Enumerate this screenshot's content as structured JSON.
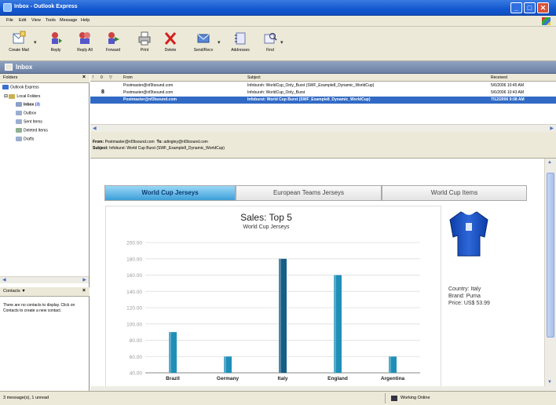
{
  "window": {
    "title": "Inbox - Outlook Express"
  },
  "menu": [
    "File",
    "Edit",
    "View",
    "Tools",
    "Message",
    "Help"
  ],
  "toolbar": {
    "buttons": [
      {
        "label": "Create Mail"
      },
      {
        "label": "Reply"
      },
      {
        "label": "Reply All"
      },
      {
        "label": "Forward"
      },
      {
        "label": "Print"
      },
      {
        "label": "Delete"
      },
      {
        "label": "Send/Recv"
      },
      {
        "label": "Addresses"
      },
      {
        "label": "Find"
      }
    ]
  },
  "folderbar": {
    "title": "Inbox"
  },
  "folders": {
    "header": "Folders",
    "items": [
      {
        "label": "Outlook Express"
      },
      {
        "label": "Local Folders"
      },
      {
        "label": "Inbox",
        "count": "(3)"
      },
      {
        "label": "Outbox"
      },
      {
        "label": "Sent Items"
      },
      {
        "label": "Deleted Items"
      },
      {
        "label": "Drafts"
      }
    ]
  },
  "contacts": {
    "header": "Contacts ▼",
    "message": "There are no contacts to display. Click on Contacts to create a new contact."
  },
  "message_list": {
    "columns": [
      "!",
      "0",
      "▽",
      "From",
      "Subject",
      "Received"
    ],
    "rows": [
      {
        "from": "Postmaster@nf3tsound.com",
        "subject": "Infobursh: WorldCup_Only_Burst (SWF_Example8_Dynamic_WorldCup)",
        "received": "5/6/2006 10:45 AM",
        "selected": false
      },
      {
        "from": "Postmaster@nf3tsound.com",
        "subject": "Infobursh: WorldCup_Only_Burst",
        "received": "5/6/2006 10:43 AM",
        "selected": false
      },
      {
        "from": "Postmaster@nf3tsound.com",
        "subject": "Infoburst: World Cup Burst (SWF_Example8_Dynamic_WorldCup)",
        "received": "7/12/2006 9:08 AM",
        "selected": true
      }
    ]
  },
  "preview": {
    "from_label": "From:",
    "from": "Postmaster@nf3tsound.com",
    "to_label": "To:",
    "to": "adingley@nf3tsound.com",
    "subject_label": "Subject:",
    "subject": "Infoburst: World Cup Burst (SWF_Example8_Dynamic_WorldCup)"
  },
  "tabs": [
    {
      "label": "World Cup Jerseys",
      "active": true
    },
    {
      "label": "European Teams Jerseys",
      "active": false
    },
    {
      "label": "World Cup Items",
      "active": false
    }
  ],
  "product": {
    "country": "Country: Italy",
    "brand": "Brand: Puma",
    "price": "Price: US$ 53.99"
  },
  "chart_data": {
    "type": "bar",
    "title": "Sales: Top 5",
    "subtitle": "World Cup Jerseys",
    "categories": [
      "Brazil",
      "Germany",
      "Italy",
      "England",
      "Argentina"
    ],
    "values": [
      9000,
      6000,
      18000,
      16000,
      6000
    ],
    "ylim": [
      4000,
      20000
    ],
    "yticks": [
      4000,
      6000,
      8000,
      10000,
      12000,
      14000,
      16000,
      18000,
      20000
    ],
    "ytick_labels": [
      "40.00",
      "60.00",
      "80.00",
      "100.00",
      "120.00",
      "140.00",
      "160.00",
      "180.00",
      "200.00"
    ],
    "colors": {
      "bar": "#1f8fb8",
      "bar_highlight": "#155f86"
    }
  },
  "status": {
    "left": "3 message(s), 1 unread",
    "right": "Working Online"
  }
}
